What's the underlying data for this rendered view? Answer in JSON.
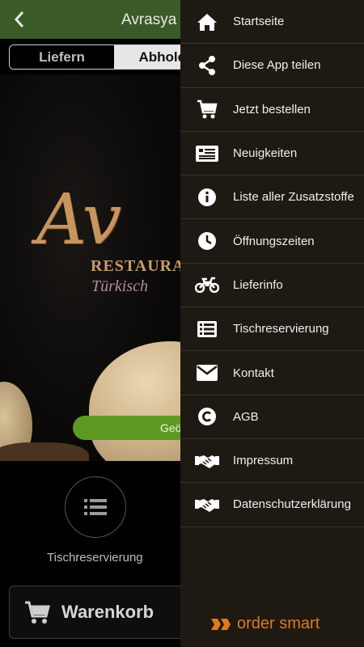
{
  "header": {
    "title": "Avrasya F"
  },
  "order_mode": {
    "options": [
      "Liefern",
      "Abholen"
    ],
    "selected": "Abholen"
  },
  "hero": {
    "logo_script": "Av",
    "logo_line1": "RESTAURA",
    "logo_line2": "Türkisch",
    "status_pill": "Geö"
  },
  "quick_action": {
    "label": "Tischreservierung",
    "icon": "list-icon"
  },
  "cart": {
    "label": "Warenkorb",
    "icon": "cart-icon"
  },
  "drawer": {
    "items": [
      {
        "label": "Startseite",
        "icon": "home-icon"
      },
      {
        "label": "Diese App teilen",
        "icon": "share-icon"
      },
      {
        "label": "Jetzt bestellen",
        "icon": "cart-icon"
      },
      {
        "label": "Neuigkeiten",
        "icon": "news-icon"
      },
      {
        "label": "Liste aller Zusatzstoffe",
        "icon": "info-icon"
      },
      {
        "label": "Öffnungszeiten",
        "icon": "clock-icon"
      },
      {
        "label": "Lieferinfo",
        "icon": "motorcycle-icon"
      },
      {
        "label": "Tischreservierung",
        "icon": "list-icon"
      },
      {
        "label": "Kontakt",
        "icon": "mail-icon"
      },
      {
        "label": "AGB",
        "icon": "copyright-icon"
      },
      {
        "label": "Impressum",
        "icon": "handshake-icon"
      },
      {
        "label": "Datenschutzerklärung",
        "icon": "handshake-icon"
      }
    ],
    "brand": "order smart"
  },
  "colors": {
    "header_bg": "#3a5a27",
    "drawer_bg": "#1e1912",
    "brand": "#e07a1c",
    "status_pill": "#5e9a23"
  }
}
